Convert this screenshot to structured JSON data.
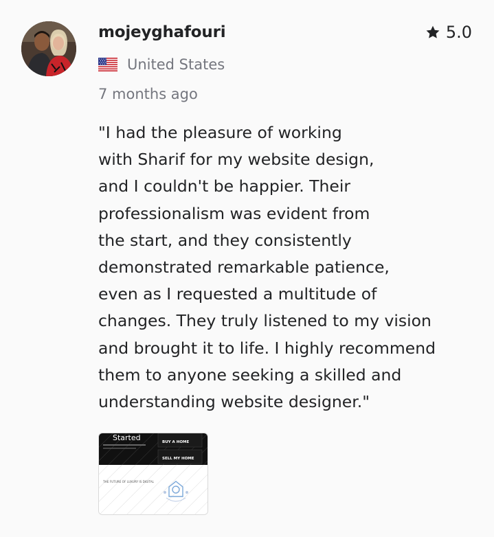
{
  "reviewer": {
    "username": "mojeyghafouri",
    "country": "United States",
    "flag_icon": "us-flag-icon",
    "avatar_icon": "user-avatar"
  },
  "rating": {
    "value": "5.0",
    "icon": "star-icon"
  },
  "timestamp": "7 months ago",
  "review_text": "\"I had the pleasure of working\nwith Sharif for my website design,\nand I couldn't be happier. Their\nprofessionalism was evident from\nthe start, and they consistently\ndemonstrated remarkable patience,\neven as I requested a multitude of\nchanges. They truly listened to my vision\nand brought it to life. I highly recommend\nthem to anyone seeking a skilled and\nunderstanding website designer.\"",
  "attachment": {
    "heading": "Started",
    "tile_1": "BUY A HOME",
    "tile_2": "SELL MY HOME",
    "caption": "THE FUTURE OF LUXURY IS DIGITAL"
  },
  "colors": {
    "text": "#222325",
    "muted": "#74767e",
    "background": "#fafafa"
  }
}
